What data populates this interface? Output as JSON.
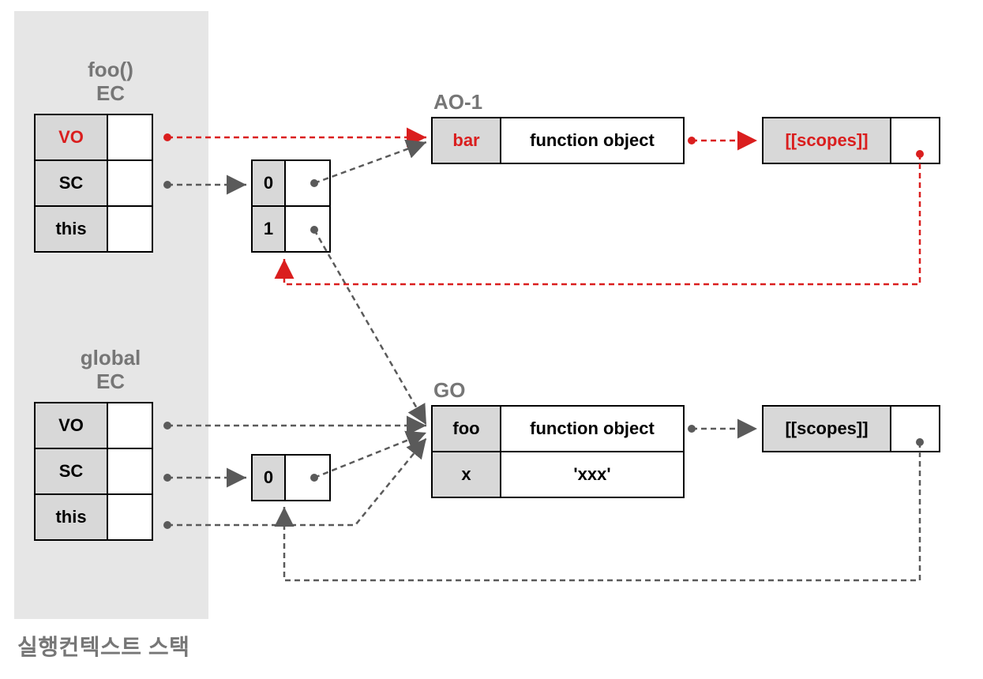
{
  "stack": {
    "caption": "실행컨텍스트 스택",
    "contexts": [
      {
        "title": "foo()\nEC",
        "rows": [
          {
            "key": "VO",
            "highlight": true
          },
          {
            "key": "SC"
          },
          {
            "key": "this"
          }
        ]
      },
      {
        "title": "global\nEC",
        "rows": [
          {
            "key": "VO"
          },
          {
            "key": "SC"
          },
          {
            "key": "this"
          }
        ]
      }
    ]
  },
  "scopeChains": {
    "foo": [
      "0",
      "1"
    ],
    "global": [
      "0"
    ]
  },
  "objects": {
    "ao1": {
      "title": "AO-1",
      "rows": [
        {
          "key": "bar",
          "value": "function object",
          "highlightKey": true
        }
      ]
    },
    "go": {
      "title": "GO",
      "rows": [
        {
          "key": "foo",
          "value": "function object"
        },
        {
          "key": "x",
          "value": "'xxx'"
        }
      ]
    }
  },
  "scopesBoxes": {
    "bar": {
      "label": "[[scopes]]",
      "highlight": true
    },
    "foo": {
      "label": "[[scopes]]"
    }
  }
}
